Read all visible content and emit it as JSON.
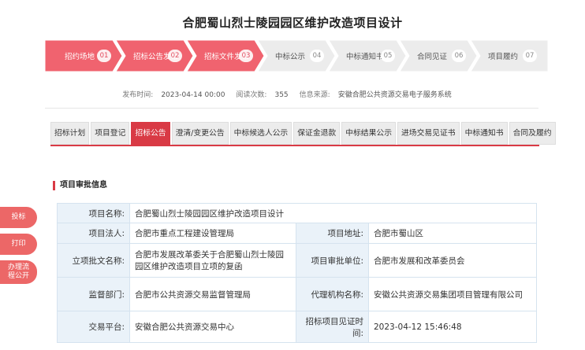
{
  "page": {
    "title": "合肥蜀山烈士陵园园区维护改造项目设计"
  },
  "steps": [
    {
      "label": "招约场地",
      "num": "01",
      "active": true
    },
    {
      "label": "招标公告发布",
      "num": "02",
      "active": true
    },
    {
      "label": "招标文件发布",
      "num": "03",
      "active": true
    },
    {
      "label": "中标公示",
      "num": "04",
      "active": false
    },
    {
      "label": "中标通知书",
      "num": "05",
      "active": false
    },
    {
      "label": "合同见证",
      "num": "06",
      "active": false
    },
    {
      "label": "项目履约",
      "num": "07",
      "active": false
    }
  ],
  "meta": {
    "publish_label": "发布时间:",
    "publish_value": "2023-04-14 00:00",
    "views_label": "阅读次数:",
    "views_value": "355",
    "source_label": "信息来源:",
    "source_value": "安徽合肥公共资源交易电子服务系统"
  },
  "tabs": [
    {
      "label": "招标计划",
      "active": false
    },
    {
      "label": "项目登记",
      "active": false
    },
    {
      "label": "招标公告",
      "active": true
    },
    {
      "label": "澄清/变更公告",
      "active": false
    },
    {
      "label": "中标候选人公示",
      "active": false
    },
    {
      "label": "保证金退款",
      "active": false
    },
    {
      "label": "中标结果公示",
      "active": false
    },
    {
      "label": "进场交易见证书",
      "active": false
    },
    {
      "label": "中标通知书",
      "active": false
    },
    {
      "label": "合同及履约",
      "active": false
    }
  ],
  "section": {
    "title": "项目审批信息"
  },
  "side": {
    "bid": "投标",
    "print": "打印",
    "process_line1": "办理流",
    "process_line2": "程公开"
  },
  "info": {
    "project_name_label": "项目名称:",
    "project_name_value": "合肥蜀山烈士陵园园区维护改造项目设计",
    "legal_label": "项目法人:",
    "legal_value": "合肥市重点工程建设管理局",
    "location_label": "项目地址:",
    "location_value": "合肥市蜀山区",
    "approval_doc_label": "立项批文名称:",
    "approval_doc_value": "合肥市发展改革委关于合肥蜀山烈士陵园园区维护改造项目立项的复函",
    "approval_unit_label": "项目审批单位:",
    "approval_unit_value": "合肥市发展和改革委员会",
    "supervisor_label": "监督部门:",
    "supervisor_value": "合肥市公共资源交易监督管理局",
    "agency_label": "代理机构名称:",
    "agency_value": "安徽公共资源交易集团项目管理有限公司",
    "platform_label": "交易平台:",
    "platform_value": "安徽合肥公共资源交易中心",
    "witness_time_label": "招标项目见证时间:",
    "witness_time_value": "2023-04-12 15:46:48"
  },
  "colors": {
    "accent": "#d93a45",
    "step_active": "#f0636f",
    "step_inactive": "#ececec",
    "table_key_bg": "#eaf2f9",
    "table_border": "#d5e3ef"
  }
}
